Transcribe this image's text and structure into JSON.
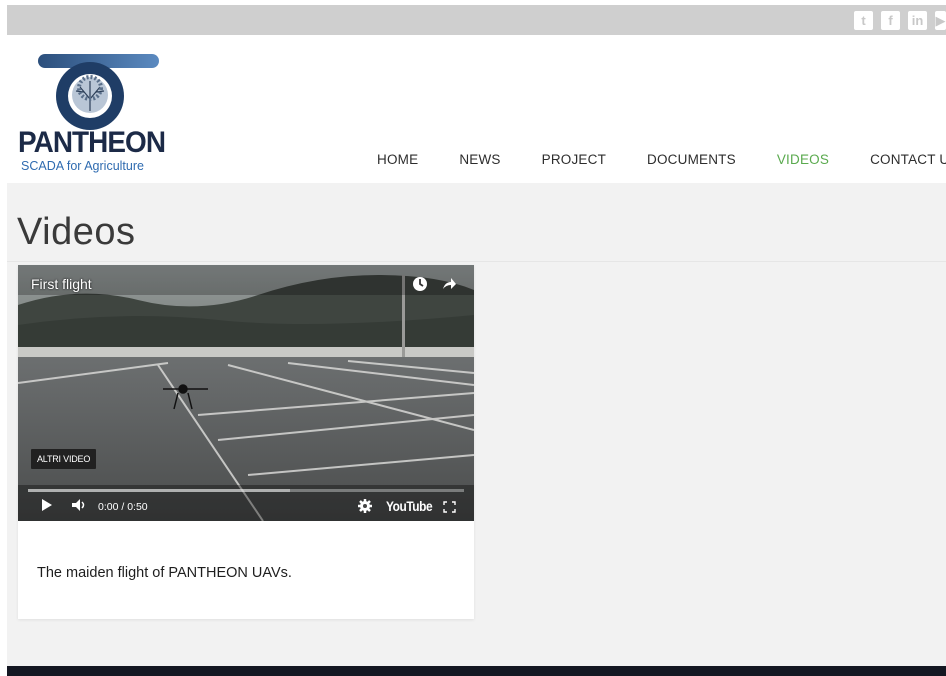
{
  "social": {
    "icons": [
      "twitter-icon",
      "facebook-icon",
      "linkedin-icon",
      "youtube-icon"
    ],
    "glyphs": [
      "t",
      "f",
      "in",
      "▶"
    ]
  },
  "logo": {
    "word": "PANTHEON",
    "subtitle": "SCADA for Agriculture"
  },
  "nav": {
    "items": [
      "HOME",
      "NEWS",
      "PROJECT",
      "DOCUMENTS",
      "VIDEOS",
      "CONTACT US"
    ],
    "active": "VIDEOS"
  },
  "page": {
    "title": "Videos"
  },
  "video": {
    "title": "First flight",
    "more_videos_label": "ALTRI VIDEO",
    "time": "0:00 / 0:50",
    "brand": "YouTube",
    "progress": 0
  },
  "card": {
    "caption": "The maiden flight of PANTHEON UAVs."
  },
  "colors": {
    "topbar": "#cfcfcf",
    "nav_active": "#5aaa4e",
    "logo_dark": "#1c2a47",
    "logo_blue": "#2f6bb0",
    "footer": "#141722"
  }
}
